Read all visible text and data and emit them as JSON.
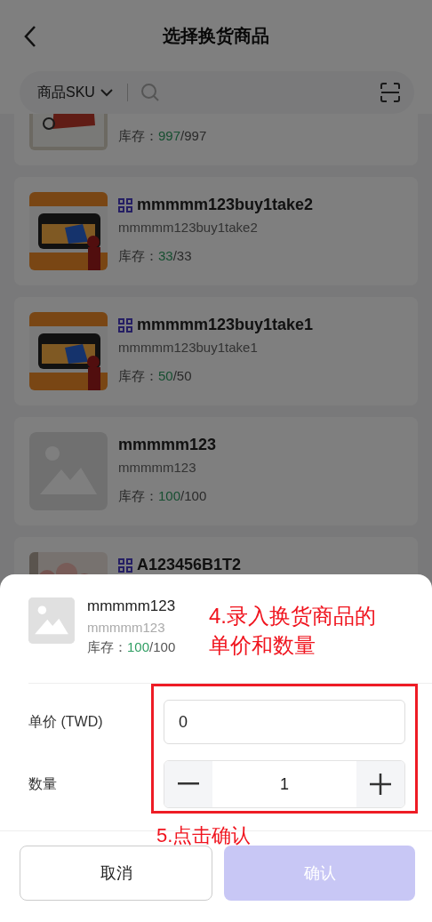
{
  "header": {
    "title": "选择换货商品"
  },
  "search": {
    "filter_label": "商品SKU"
  },
  "products": [
    {
      "kind": "picture",
      "stock": {
        "label": "库存：",
        "available": "997",
        "total": "/997"
      }
    },
    {
      "kind": "picture",
      "bundle": true,
      "title": "mmmmm123buy1take2",
      "subtitle": "mmmmm123buy1take2",
      "stock": {
        "label": "库存：",
        "available": "33",
        "total": "/33"
      }
    },
    {
      "kind": "picture",
      "bundle": true,
      "title": "mmmmm123buy1take1",
      "subtitle": "mmmmm123buy1take1",
      "stock": {
        "label": "库存：",
        "available": "50",
        "total": "/50"
      }
    },
    {
      "kind": "placeholder",
      "bundle": false,
      "title": "mmmmm123",
      "subtitle": "mmmmm123",
      "stock": {
        "label": "库存：",
        "available": "100",
        "total": "/100"
      }
    },
    {
      "kind": "picture",
      "bundle": true,
      "title": "A123456B1T2"
    }
  ],
  "sheet": {
    "product": {
      "title": "mmmmm123",
      "subtitle": "mmmmm123",
      "stock": {
        "label": "库存：",
        "available": "100",
        "total": "/100"
      }
    },
    "price": {
      "label": "单价 (TWD)",
      "value": "0"
    },
    "quantity": {
      "label": "数量",
      "value": "1"
    },
    "buttons": [
      {
        "label": "取消",
        "kind": "cancel",
        "disabled": false
      },
      {
        "label": "确认",
        "kind": "confirm",
        "disabled": true
      }
    ]
  },
  "annotations": [
    {
      "text": "4.录入换货商品的单价和数量"
    },
    {
      "text": "5.点击确认"
    }
  ]
}
